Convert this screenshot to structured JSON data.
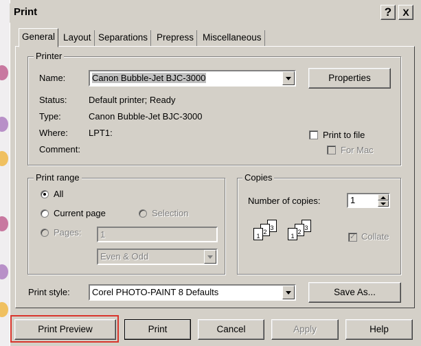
{
  "window": {
    "title": "Print"
  },
  "titlebar_buttons": {
    "help_glyph": "?",
    "close_glyph": "X"
  },
  "tabs": [
    {
      "label": "General",
      "active": true
    },
    {
      "label": "Layout"
    },
    {
      "label": "Separations"
    },
    {
      "label": "Prepress"
    },
    {
      "label": "Miscellaneous"
    }
  ],
  "printer": {
    "group_label": "Printer",
    "name_label": "Name:",
    "name_value": "Canon Bubble-Jet BJC-3000",
    "properties_label": "Properties",
    "status_label": "Status:",
    "status_value": "Default printer; Ready",
    "type_label": "Type:",
    "type_value": "Canon Bubble-Jet BJC-3000",
    "where_label": "Where:",
    "where_value": "LPT1:",
    "comment_label": "Comment:",
    "print_to_file_label": "Print to file",
    "for_mac_label": "For Mac"
  },
  "print_range": {
    "group_label": "Print range",
    "all_label": "All",
    "current_page_label": "Current page",
    "selection_label": "Selection",
    "pages_label": "Pages:",
    "pages_value": "1",
    "subset_value": "Even & Odd"
  },
  "copies": {
    "group_label": "Copies",
    "number_label": "Number of copies:",
    "number_value": "1",
    "collate_label": "Collate",
    "page_numbers": [
      "1",
      "2",
      "3"
    ]
  },
  "print_style": {
    "label": "Print style:",
    "value": "Corel PHOTO-PAINT 8 Defaults",
    "save_as_label": "Save As..."
  },
  "buttons": {
    "print_preview": "Print Preview",
    "print": "Print",
    "cancel": "Cancel",
    "apply": "Apply",
    "help": "Help"
  },
  "colors": {
    "highlight_box": "#d9342b",
    "dialog_bg": "#d4d0c8"
  }
}
